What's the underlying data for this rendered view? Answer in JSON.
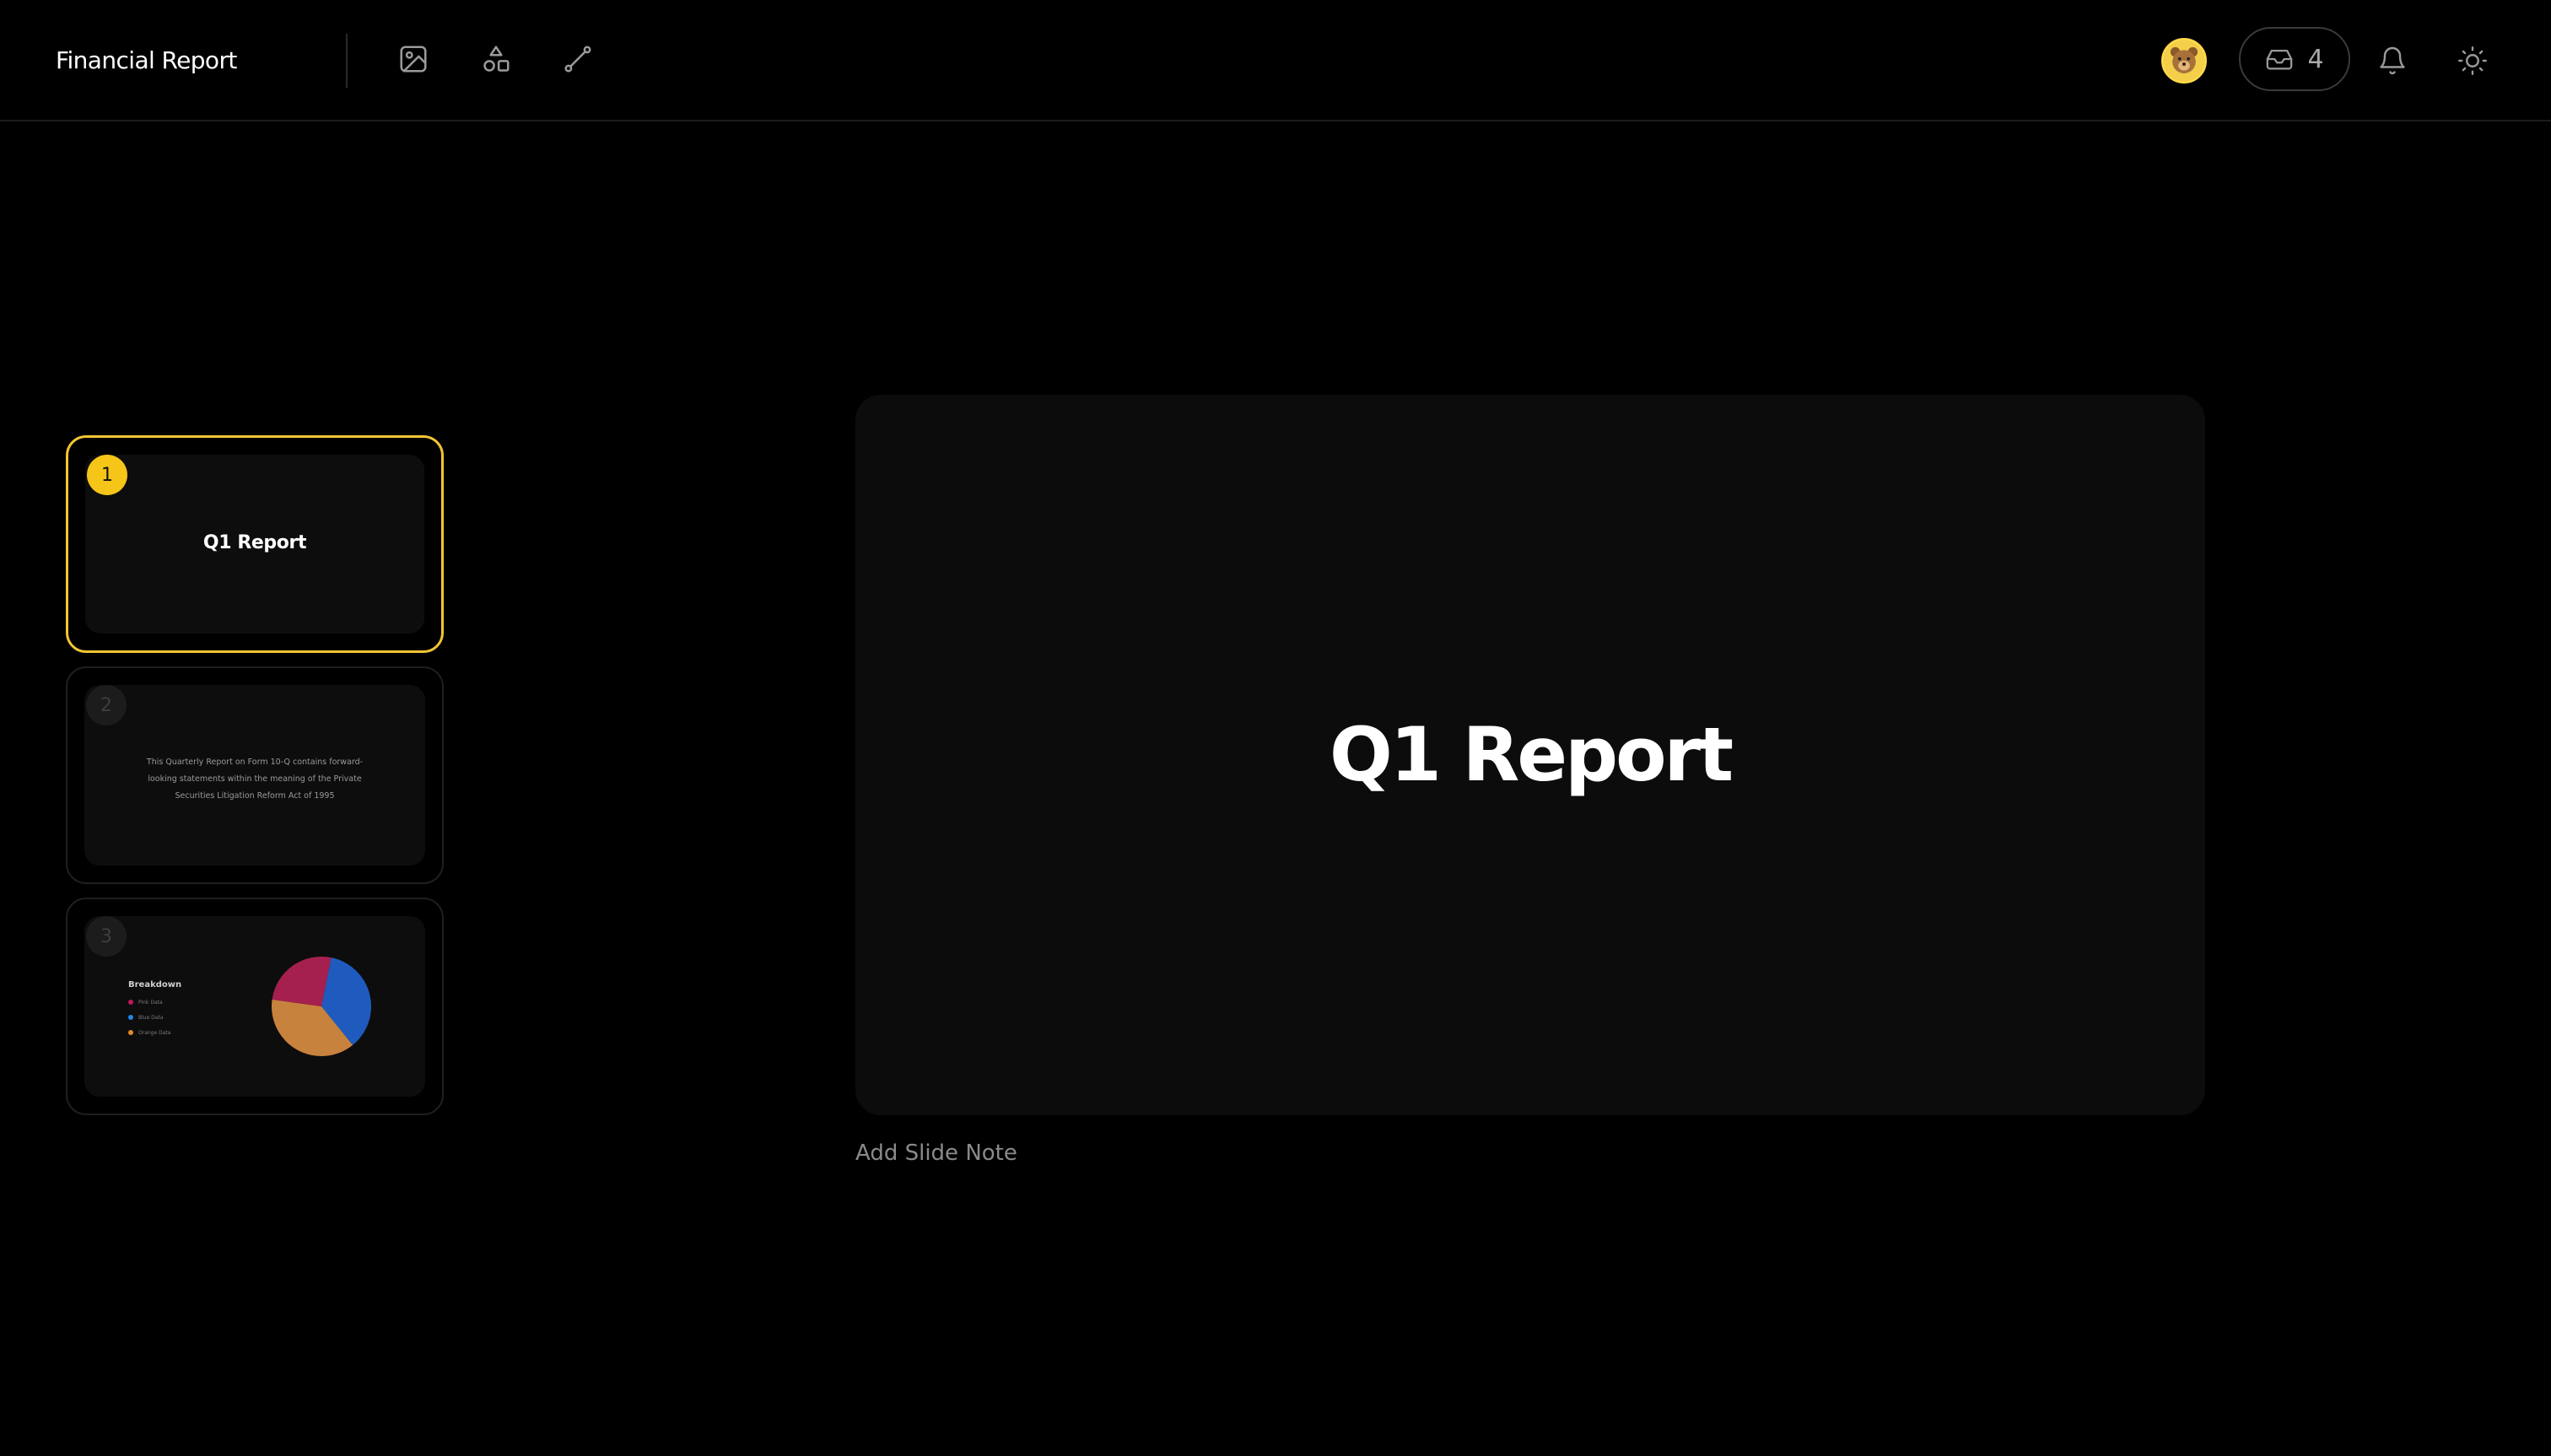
{
  "header": {
    "title": "Financial Report",
    "tools": [
      {
        "icon": "image-icon"
      },
      {
        "icon": "shapes-icon"
      },
      {
        "icon": "line-icon"
      }
    ],
    "inbox_count": "4",
    "icons": [
      "inbox-icon",
      "bell-icon",
      "sun-icon",
      "avatar"
    ]
  },
  "slides": [
    {
      "number": "1",
      "title": "Q1 Report",
      "active": true
    },
    {
      "number": "2",
      "text": "This Quarterly Report on Form 10-Q contains forward-looking statements within the meaning of the Private Securities Litigation Reform Act of 1995"
    },
    {
      "number": "3",
      "legend_title": "Breakdown",
      "legend": [
        {
          "label": "Pink Data",
          "color": "#c2185b"
        },
        {
          "label": "Blue Data",
          "color": "#1e88e5"
        },
        {
          "label": "Orange Data",
          "color": "#e08a2c"
        }
      ],
      "pie_values": [
        36,
        38,
        26
      ],
      "pie_colors": [
        "#1f5bbf",
        "#c7823d",
        "#a6204f"
      ]
    }
  ],
  "main_slide": {
    "title": "Q1 Report"
  },
  "slide_note_placeholder": "Add Slide Note",
  "colors": {
    "accent": "#f2c434",
    "background": "#000000",
    "slide_bg": "#0c0c0c"
  }
}
